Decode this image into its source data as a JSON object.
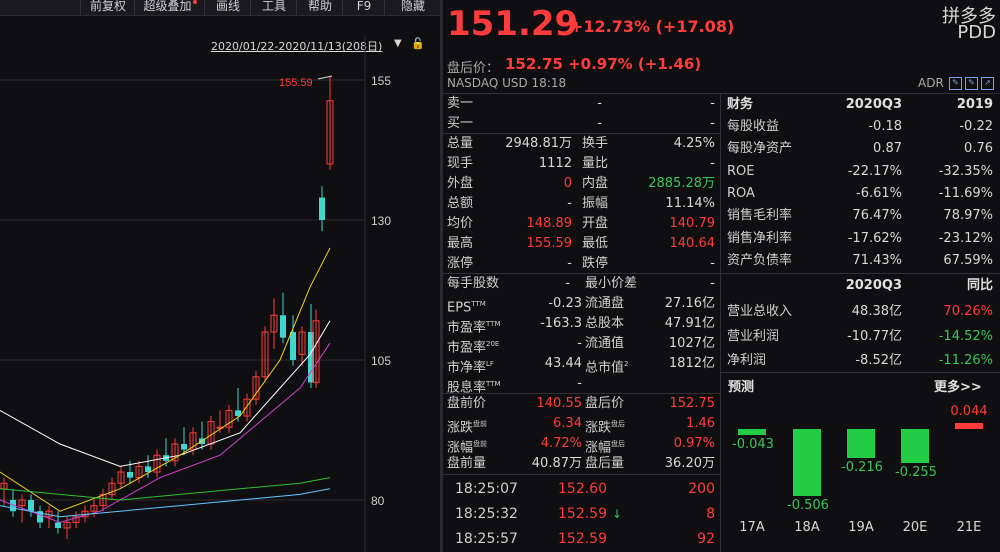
{
  "toolbar": {
    "items": [
      "前复权",
      "超级叠加",
      "画线",
      "工具",
      "帮助",
      "F9",
      "隐藏"
    ]
  },
  "chart": {
    "range_label": "2020/01/22-2020/11/13(208日)",
    "high_label": "155.59",
    "y_ticks": [
      "155",
      "130",
      "105",
      "80"
    ]
  },
  "quote": {
    "price": "151.29",
    "change": "+12.73% (+17.08)",
    "name_cn": "拼多多",
    "name_en": "PDD",
    "after_label": "盘后价：",
    "after_value": "152.75 +0.97% (+1.46)",
    "exchange": "NASDAQ  USD  18:18",
    "adr": "ADR"
  },
  "order_book": [
    {
      "label": "卖一",
      "price": "-",
      "vol": "-"
    },
    {
      "label": "买一",
      "price": "-",
      "vol": "-"
    }
  ],
  "stats1": [
    {
      "l1": "总量",
      "v1": "2948.81万",
      "c1": "white",
      "l2": "换手",
      "v2": "4.25%",
      "c2": "white"
    },
    {
      "l1": "现手",
      "v1": "1112",
      "c1": "white",
      "l2": "量比",
      "v2": "-",
      "c2": "white"
    },
    {
      "l1": "外盘",
      "v1": "0",
      "c1": "red",
      "l2": "内盘",
      "v2": "2885.28万",
      "c2": "green"
    },
    {
      "l1": "总额",
      "v1": "-",
      "c1": "white",
      "l2": "振幅",
      "v2": "11.14%",
      "c2": "white"
    },
    {
      "l1": "均价",
      "v1": "148.89",
      "c1": "red",
      "l2": "开盘",
      "v2": "140.79",
      "c2": "red"
    },
    {
      "l1": "最高",
      "v1": "155.59",
      "c1": "red",
      "l2": "最低",
      "v2": "140.64",
      "c2": "red"
    },
    {
      "l1": "涨停",
      "v1": "-",
      "c1": "white",
      "l2": "跌停",
      "v2": "-",
      "c2": "white"
    }
  ],
  "stats2_header": {
    "l1": "每手股数",
    "v1": "-",
    "l2": "最小价差",
    "v2": "-"
  },
  "stats2": [
    {
      "l1": "EPS",
      "s1": "TTM",
      "v1": "-0.23",
      "c1": "white",
      "l2": "流通盘",
      "s2": "",
      "v2": "27.16亿",
      "c2": "white"
    },
    {
      "l1": "市盈率",
      "s1": "TTM",
      "v1": "-163.3",
      "c1": "white",
      "l2": "总股本",
      "s2": "",
      "v2": "47.91亿",
      "c2": "white"
    },
    {
      "l1": "市盈率",
      "s1": "20E",
      "v1": "-",
      "c1": "white",
      "l2": "流通值",
      "s2": "",
      "v2": "1027亿",
      "c2": "white"
    },
    {
      "l1": "市净率",
      "s1": "LF",
      "v1": "43.44",
      "c1": "white",
      "l2": "总市值",
      "s2": "2",
      "v2": "1812亿",
      "c2": "white"
    },
    {
      "l1": "股息率",
      "s1": "TTM",
      "v1": "-",
      "c1": "white",
      "l2": "",
      "s2": "",
      "v2": "",
      "c2": "white"
    }
  ],
  "stats3": [
    {
      "l1": "盘前价",
      "s1": "",
      "v1": "140.55",
      "c1": "red",
      "l2": "盘后价",
      "s2": "",
      "v2": "152.75",
      "c2": "red"
    },
    {
      "l1": "涨跌",
      "s1": "盘前",
      "v1": "6.34",
      "c1": "red",
      "l2": "涨跌",
      "s2": "盘后",
      "v2": "1.46",
      "c2": "red"
    },
    {
      "l1": "涨幅",
      "s1": "盘前",
      "v1": "4.72%",
      "c1": "red",
      "l2": "涨幅",
      "s2": "盘后",
      "v2": "0.97%",
      "c2": "red"
    },
    {
      "l1": "盘前量",
      "s1": "",
      "v1": "40.87万",
      "c1": "white",
      "l2": "盘后量",
      "s2": "",
      "v2": "36.20万",
      "c2": "white"
    }
  ],
  "trades": [
    {
      "time": "18:25:07",
      "price": "152.60",
      "arrow": "",
      "vol": "200"
    },
    {
      "time": "18:25:32",
      "price": "152.59",
      "arrow": "↓",
      "vol": "8"
    },
    {
      "time": "18:25:57",
      "price": "152.59",
      "arrow": "",
      "vol": "92"
    }
  ],
  "financials": {
    "header": [
      "财务",
      "2020Q3",
      "2019"
    ],
    "rows": [
      {
        "label": "每股收益",
        "a": "-0.18",
        "ac": "white",
        "b": "-0.22",
        "bc": "white"
      },
      {
        "label": "每股净资产",
        "a": "0.87",
        "ac": "white",
        "b": "0.76",
        "bc": "white"
      },
      {
        "label": "ROE",
        "a": "-22.17%",
        "ac": "white",
        "b": "-32.35%",
        "bc": "white"
      },
      {
        "label": "ROA",
        "a": "-6.61%",
        "ac": "white",
        "b": "-11.69%",
        "bc": "white"
      },
      {
        "label": "销售毛利率",
        "a": "76.47%",
        "ac": "white",
        "b": "78.97%",
        "bc": "white"
      },
      {
        "label": "销售净利率",
        "a": "-17.62%",
        "ac": "white",
        "b": "-23.12%",
        "bc": "white"
      },
      {
        "label": "资产负债率",
        "a": "71.43%",
        "ac": "white",
        "b": "67.59%",
        "bc": "white"
      }
    ],
    "header2": [
      "",
      "2020Q3",
      "同比"
    ],
    "rows2": [
      {
        "label": "营业总收入",
        "a": "48.38亿",
        "ac": "white",
        "b": "70.26%",
        "bc": "red"
      },
      {
        "label": "营业利润",
        "a": "-10.77亿",
        "ac": "white",
        "b": "-14.52%",
        "bc": "green"
      },
      {
        "label": "净利润",
        "a": "-8.52亿",
        "ac": "white",
        "b": "-11.26%",
        "bc": "green"
      }
    ]
  },
  "forecast": {
    "title": "预测",
    "more": "更多>>",
    "colors": {
      "pos": "#ff3b3b",
      "neg": "#22cc44"
    },
    "bars": [
      {
        "year": "17A",
        "value": -0.043,
        "label": "-0.043"
      },
      {
        "year": "18A",
        "value": -0.506,
        "label": "-0.506"
      },
      {
        "year": "19A",
        "value": -0.216,
        "label": "-0.216"
      },
      {
        "year": "20E",
        "value": -0.255,
        "label": "-0.255"
      },
      {
        "year": "21E",
        "value": 0.044,
        "label": "0.044"
      }
    ]
  }
}
